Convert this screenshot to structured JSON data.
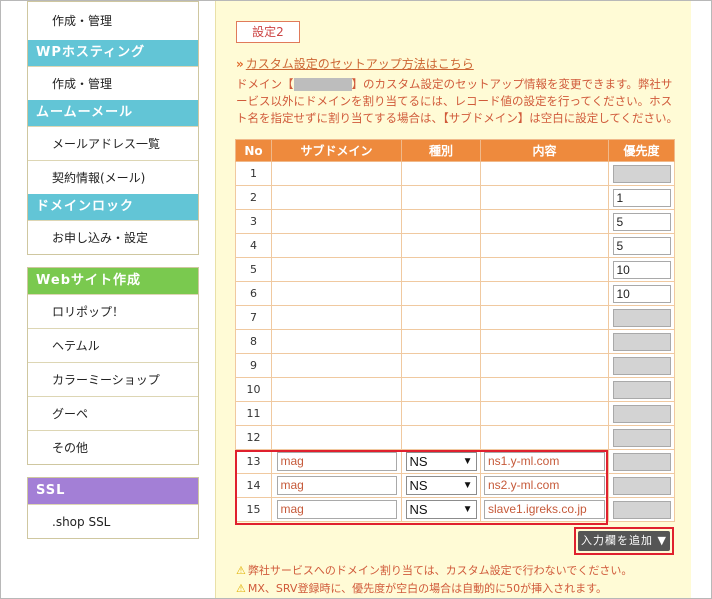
{
  "sidebar": {
    "group1_items": [
      "作成・管理"
    ],
    "wp_hosting": {
      "title": "WPホスティング",
      "items": [
        "作成・管理"
      ]
    },
    "mumumail": {
      "title": "ムームーメール",
      "items": [
        "メールアドレス一覧",
        "契約情報(メール)"
      ]
    },
    "domain_lock": {
      "title": "ドメインロック",
      "items": [
        "お申し込み・設定"
      ]
    },
    "website": {
      "title": "Webサイト作成",
      "items": [
        "ロリポップ！",
        "ヘテムル",
        "カラーミーショップ",
        "グーペ",
        "その他"
      ]
    },
    "ssl": {
      "title": "SSL",
      "items": [
        ".shop SSL"
      ]
    }
  },
  "main": {
    "tab_label": "設定2",
    "setup_link": "カスタム設定のセットアップ方法はこちら",
    "desc_prefix": "ドメイン【",
    "desc_suffix": "】のカスタム設定のセットアップ情報を変更できます。弊社サービス以外にドメインを割り当てるには、レコード値の設定を行ってください。ホスト名を指定せずに割り当てする場合は、【サブドメイン】は空白に設定してください。",
    "add_row_button": "入力欄を追加 ▼",
    "notes": [
      "弊社サービスへのドメイン割り当ては、カスタム設定で行わないでください。",
      "MX、SRV登録時に、優先度が空白の場合は自動的に50が挿入されます。"
    ]
  },
  "table": {
    "headers": [
      "No",
      "サブドメイン",
      "種別",
      "内容",
      "優先度"
    ],
    "masked_rows": [
      {
        "no": "1",
        "priority": ""
      },
      {
        "no": "2",
        "priority": "1"
      },
      {
        "no": "3",
        "priority": "5"
      },
      {
        "no": "4",
        "priority": "5"
      },
      {
        "no": "5",
        "priority": "10"
      },
      {
        "no": "6",
        "priority": "10"
      },
      {
        "no": "7",
        "priority": ""
      },
      {
        "no": "8",
        "priority": ""
      },
      {
        "no": "9",
        "priority": ""
      },
      {
        "no": "10",
        "priority": ""
      },
      {
        "no": "11",
        "priority": ""
      },
      {
        "no": "12",
        "priority": ""
      }
    ],
    "input_rows": [
      {
        "no": "13",
        "subdomain": "mag",
        "type": "NS",
        "content": "ns1.y-ml.com",
        "priority": ""
      },
      {
        "no": "14",
        "subdomain": "mag",
        "type": "NS",
        "content": "ns2.y-ml.com",
        "priority": ""
      },
      {
        "no": "15",
        "subdomain": "mag",
        "type": "NS",
        "content": "slave1.igreks.co.jp",
        "priority": ""
      }
    ]
  },
  "colors": {
    "accent_orange": "#ee8a3d",
    "highlight_red": "#e0202e",
    "side_cyan": "#62c5d6",
    "side_green": "#7ac94f",
    "side_purple": "#a37fd6"
  }
}
